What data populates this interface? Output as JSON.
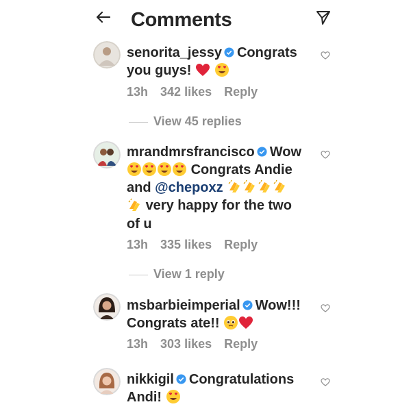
{
  "header": {
    "title": "Comments",
    "back_icon": "back-arrow-icon",
    "send_icon": "paper-plane-icon"
  },
  "comments": [
    {
      "username": "senorita_jessy",
      "text_lines": [
        "Congrats",
        "you guys!"
      ],
      "time": "13h",
      "likes": "342 likes",
      "reply": "Reply",
      "view_replies": "View 45 replies"
    },
    {
      "username": "mrandmrsfrancisco",
      "text_word": "Wow",
      "line2": "Congrats Andie",
      "line3_prefix": "and",
      "mention": "@chepoxz",
      "line4": "very happy for the two",
      "line5": "of u",
      "time": "13h",
      "likes": "335 likes",
      "reply": "Reply",
      "view_replies": "View 1 reply"
    },
    {
      "username": "msbarbieimperial",
      "text_word": "Wow!!!",
      "line2": "Congrats ate!!",
      "time": "13h",
      "likes": "303 likes",
      "reply": "Reply"
    },
    {
      "username": "nikkigil",
      "text_word": "Congratulations",
      "line2": "Andi!"
    }
  ],
  "colors": {
    "text": "#262626",
    "muted": "#8e8e8e",
    "verified": "#3897f0",
    "mention": "#1a3e72",
    "heart_red": "#e0243a",
    "emoji_yellow": "#ffcc33"
  }
}
